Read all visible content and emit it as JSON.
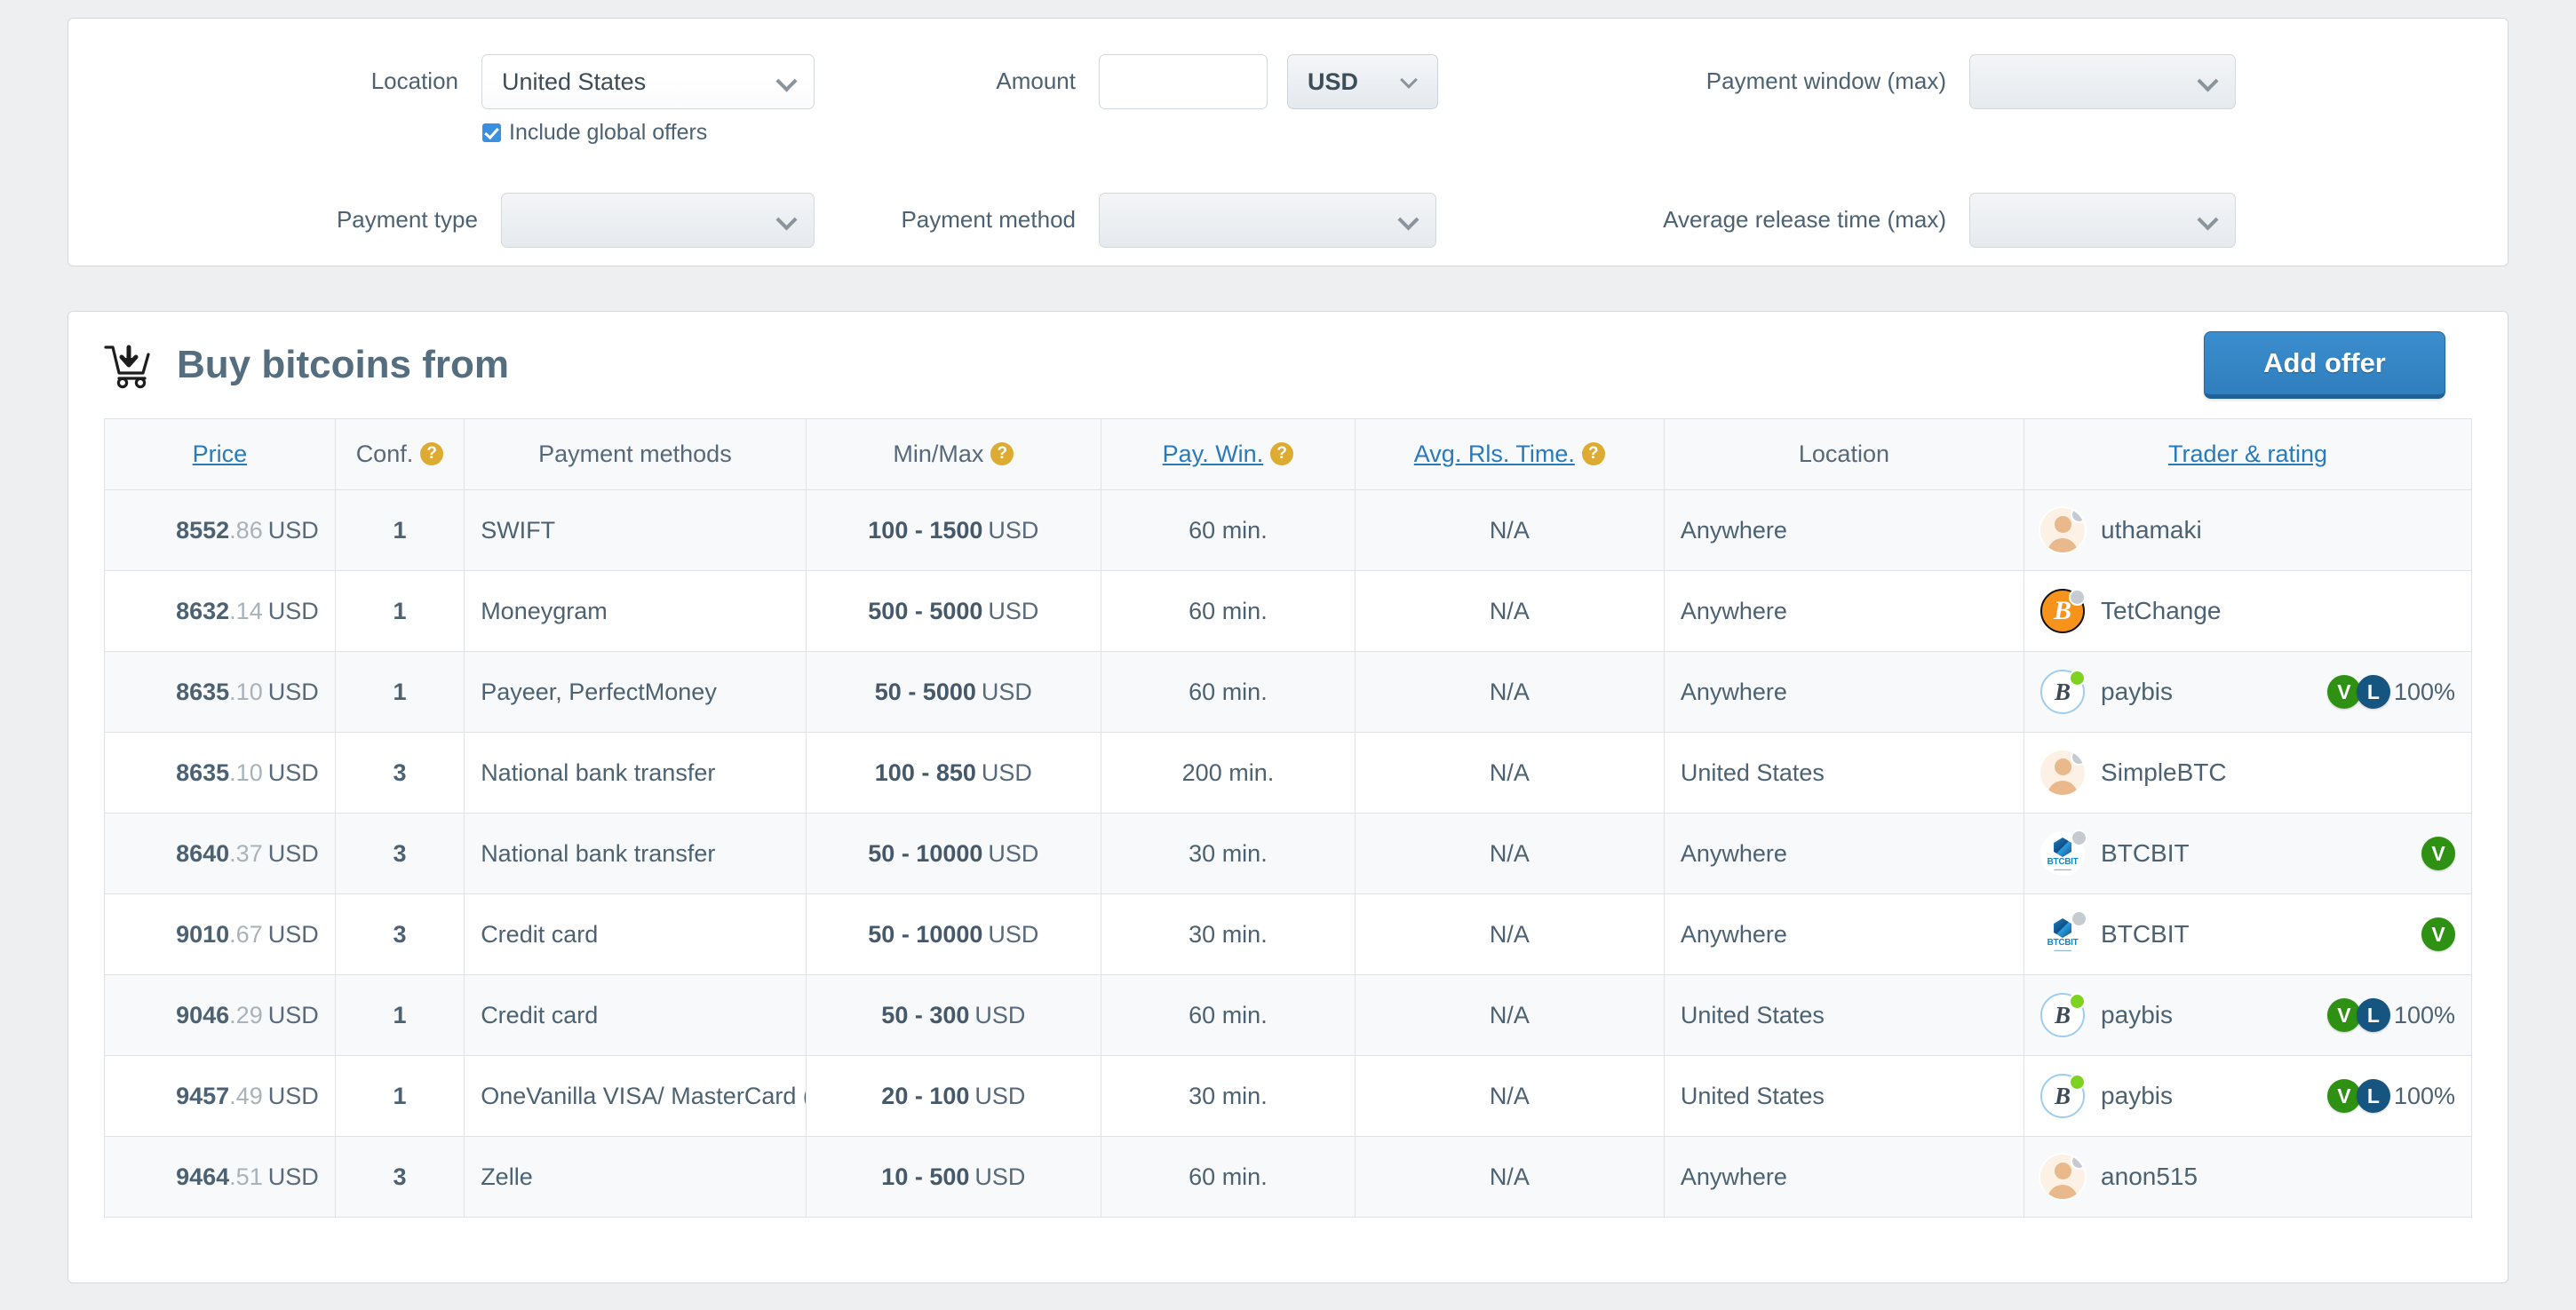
{
  "filters": {
    "location": {
      "label": "Location",
      "value": "United States"
    },
    "include_global": {
      "label": "Include global offers",
      "checked": true
    },
    "payment_type": {
      "label": "Payment type",
      "value": ""
    },
    "amount": {
      "label": "Amount",
      "value": "",
      "placeholder": ""
    },
    "currency": {
      "label": "",
      "value": "USD"
    },
    "payment_method": {
      "label": "Payment method",
      "value": ""
    },
    "payment_window": {
      "label": "Payment window (max)",
      "value": ""
    },
    "avg_release_time": {
      "label": "Average release time (max)",
      "value": ""
    }
  },
  "results": {
    "title": "Buy bitcoins from",
    "cart_icon": "cart-download-icon",
    "add_offer_label": "Add offer",
    "columns": [
      {
        "label": "Price",
        "link": true,
        "help": false
      },
      {
        "label": "Conf.",
        "link": false,
        "help": true
      },
      {
        "label": "Payment methods",
        "link": false,
        "help": false
      },
      {
        "label": "Min/Max",
        "link": false,
        "help": true
      },
      {
        "label": "Pay. Win.",
        "link": true,
        "help": true
      },
      {
        "label": "Avg. Rls. Time.",
        "link": true,
        "help": true
      },
      {
        "label": "Location",
        "link": false,
        "help": false
      },
      {
        "label": "Trader & rating",
        "link": true,
        "help": false
      }
    ],
    "rows": [
      {
        "price_int": "8552",
        "price_dec": ".86",
        "price_cur": "USD",
        "conf": "1",
        "methods": "SWIFT",
        "mm": "100 - 1500",
        "mm_cur": "USD",
        "pw": "60 min.",
        "rls": "N/A",
        "loc": "Anywhere",
        "trader": "uthamaki",
        "avatar": "person",
        "status": "off",
        "badges": [],
        "pct": ""
      },
      {
        "price_int": "8632",
        "price_dec": ".14",
        "price_cur": "USD",
        "conf": "1",
        "methods": "Moneygram",
        "mm": "500 - 5000",
        "mm_cur": "USD",
        "pw": "60 min.",
        "rls": "N/A",
        "loc": "Anywhere",
        "trader": "TetChange",
        "avatar": "btc-orange",
        "status": "off",
        "badges": [],
        "pct": ""
      },
      {
        "price_int": "8635",
        "price_dec": ".10",
        "price_cur": "USD",
        "conf": "1",
        "methods": "Payeer, PerfectMoney",
        "mm": "50 - 5000",
        "mm_cur": "USD",
        "pw": "60 min.",
        "rls": "N/A",
        "loc": "Anywhere",
        "trader": "paybis",
        "avatar": "btc-light",
        "status": "on",
        "badges": [
          "V",
          "L"
        ],
        "pct": "100%"
      },
      {
        "price_int": "8635",
        "price_dec": ".10",
        "price_cur": "USD",
        "conf": "3",
        "methods": "National bank transfer",
        "mm": "100 - 850",
        "mm_cur": "USD",
        "pw": "200 min.",
        "rls": "N/A",
        "loc": "United States",
        "trader": "SimpleBTC",
        "avatar": "person",
        "status": "off",
        "badges": [],
        "pct": ""
      },
      {
        "price_int": "8640",
        "price_dec": ".37",
        "price_cur": "USD",
        "conf": "3",
        "methods": "National bank transfer",
        "mm": "50 - 10000",
        "mm_cur": "USD",
        "pw": "30 min.",
        "rls": "N/A",
        "loc": "Anywhere",
        "trader": "BTCBIT",
        "avatar": "btcbit",
        "status": "off",
        "badges": [
          "V"
        ],
        "pct": ""
      },
      {
        "price_int": "9010",
        "price_dec": ".67",
        "price_cur": "USD",
        "conf": "3",
        "methods": "Credit card",
        "mm": "50 - 10000",
        "mm_cur": "USD",
        "pw": "30 min.",
        "rls": "N/A",
        "loc": "Anywhere",
        "trader": "BTCBIT",
        "avatar": "btcbit",
        "status": "off",
        "badges": [
          "V"
        ],
        "pct": ""
      },
      {
        "price_int": "9046",
        "price_dec": ".29",
        "price_cur": "USD",
        "conf": "1",
        "methods": "Credit card",
        "mm": "50 - 300",
        "mm_cur": "USD",
        "pw": "60 min.",
        "rls": "N/A",
        "loc": "United States",
        "trader": "paybis",
        "avatar": "btc-light",
        "status": "on",
        "badges": [
          "V",
          "L"
        ],
        "pct": "100%"
      },
      {
        "price_int": "9457",
        "price_dec": ".49",
        "price_cur": "USD",
        "conf": "1",
        "methods": "OneVanilla VISA/ MasterCard (",
        "mm": "20 - 100",
        "mm_cur": "USD",
        "pw": "30 min.",
        "rls": "N/A",
        "loc": "United States",
        "trader": "paybis",
        "avatar": "btc-light",
        "status": "on",
        "badges": [
          "V",
          "L"
        ],
        "pct": "100%"
      },
      {
        "price_int": "9464",
        "price_dec": ".51",
        "price_cur": "USD",
        "conf": "3",
        "methods": "Zelle",
        "mm": "10 - 500",
        "mm_cur": "USD",
        "pw": "60 min.",
        "rls": "N/A",
        "loc": "Anywhere",
        "trader": "anon515",
        "avatar": "person",
        "status": "off",
        "badges": [],
        "pct": ""
      }
    ]
  },
  "colors": {
    "accent_blue": "#2a7ab9",
    "button_blue": "#3c8dcd",
    "help_gold": "#ddab31",
    "badge_green": "#2f9113",
    "badge_navy": "#15557f",
    "online_green": "#7ed321",
    "offline_gray": "#c5cbd1",
    "text": "#4c6272"
  }
}
